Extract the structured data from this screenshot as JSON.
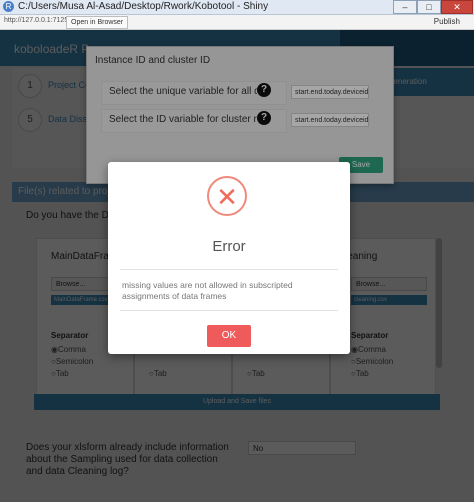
{
  "window": {
    "title": "C:/Users/Musa Al-Asad/Desktop/Rwork/Kobotool - Shiny",
    "minimize": "–",
    "maximize": "□",
    "close": "✕"
  },
  "toolbar": {
    "address": "http://127.0.0.1:7125",
    "open_in_browser": "Open in Browser",
    "publish": "Publish"
  },
  "app": {
    "brand": "koboloadeR Pac",
    "steps": [
      {
        "num": "1",
        "label": "Project Configuration"
      },
      {
        "num": "5",
        "label": "Data Dissemination"
      }
    ],
    "step_right_label": "Generation",
    "files_header": "File(s) related to project",
    "data_question": "Do you have the Data",
    "panels": [
      {
        "title": "MainDataFrame",
        "browse": "Browse...",
        "file": "MainDataFrame.csv"
      },
      {
        "title": "",
        "browse": "Browse...",
        "file": ""
      },
      {
        "title": "",
        "browse": "Browse...",
        "file": ""
      },
      {
        "title": "leaning",
        "browse": "Browse...",
        "file": "cleaning.csv"
      }
    ],
    "separator_label": "Separator",
    "separator_options": [
      "Comma",
      "Semicolon",
      "Tab"
    ],
    "upload_label": "Upload and Save files",
    "sampling_question": "Does your xlsform already include information about the Sampling used for data collection and data Cleaning log?",
    "sampling_value": "No"
  },
  "id_modal": {
    "title": "Instance ID and cluster ID",
    "rows": [
      {
        "label": "Select the unique variable for all data",
        "value": "start.end.today.deviceid"
      },
      {
        "label": "Select the ID variable for cluster report",
        "value": "start.end.today.deviceid"
      }
    ],
    "help_glyph": "?",
    "save_label": "Save"
  },
  "error_modal": {
    "title": "Error",
    "message": "missing values are not allowed in subscripted assignments of data frames",
    "ok_label": "OK",
    "icon_glyph": "✕"
  }
}
